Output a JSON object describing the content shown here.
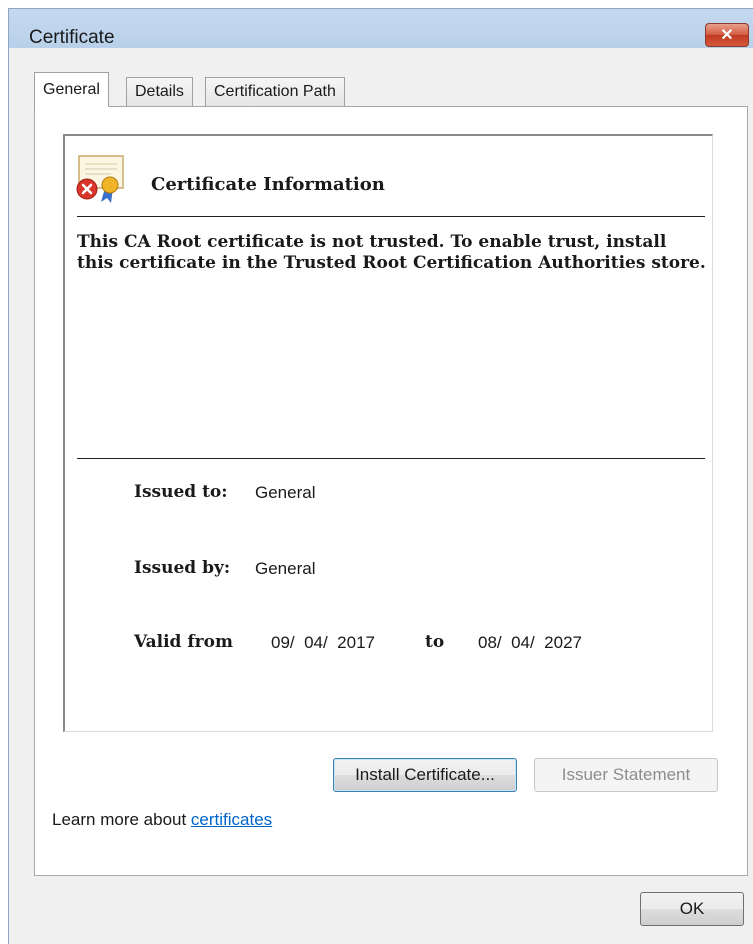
{
  "window": {
    "title": "Certificate"
  },
  "tabs": [
    {
      "label": "General",
      "active": true
    },
    {
      "label": "Details",
      "active": false
    },
    {
      "label": "Certification Path",
      "active": false
    }
  ],
  "info": {
    "heading": "Certificate Information",
    "warning": "This CA Root certificate is not trusted. To enable trust, install this certificate in the Trusted Root Certification Authorities store.",
    "icon": "certificate-error-icon"
  },
  "details": {
    "issued_to_label": "Issued to:",
    "issued_to_value": "General",
    "issued_by_label": "Issued by:",
    "issued_by_value": "General",
    "valid_from_label": "Valid from",
    "valid_from_value": "09/  04/  2017",
    "to_label": "to",
    "valid_to_value": "08/  04/  2027"
  },
  "buttons": {
    "install": "Install Certificate...",
    "issuer_statement": "Issuer Statement",
    "ok": "OK"
  },
  "footer": {
    "learn_more_prefix": "Learn more about ",
    "learn_more_link": "certificates"
  },
  "colors": {
    "link": "#0066cc",
    "close": "#c0391f",
    "titlebar": "#bcd2eb"
  }
}
